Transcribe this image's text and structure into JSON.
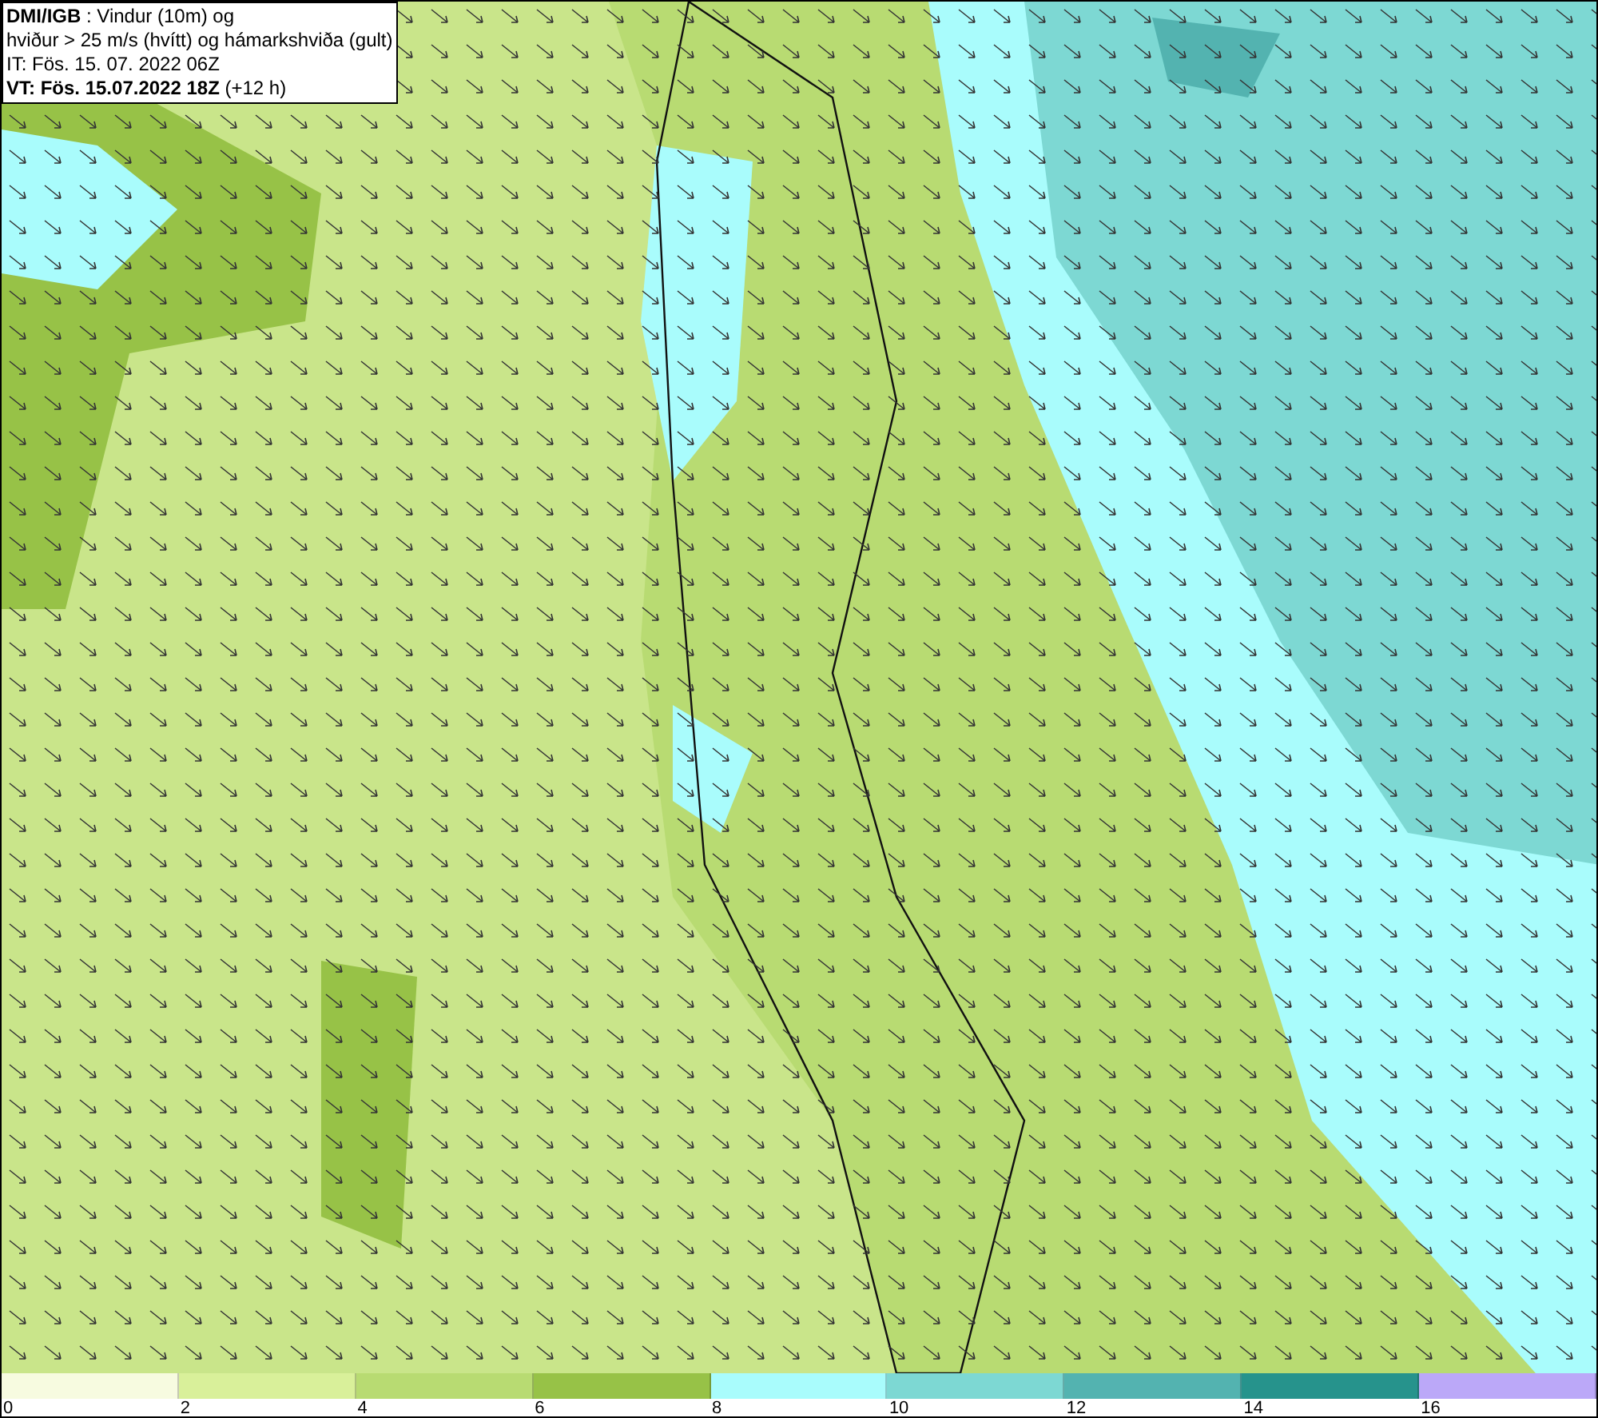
{
  "title_box": {
    "lines": [
      "**DMI/IGB** : Vindur (10m) og",
      "hviður > 25 m/s (hvítt) og hámarkshviða (gult)",
      "IT: Fös. 15. 07. 2022 06Z",
      "**VT: Fös. 15.07.2022 18Z** (+12 h)"
    ]
  },
  "legend": {
    "bins": [
      {
        "color": "#f7fbe0"
      },
      {
        "color": "#d9f09a"
      },
      {
        "color": "#b8db72"
      },
      {
        "color": "#97c247"
      },
      {
        "color": "#a9fcfc"
      },
      {
        "color": "#7dd8d3"
      },
      {
        "color": "#53b3b0"
      },
      {
        "color": "#26938c"
      },
      {
        "color": "#bba8f8"
      }
    ],
    "ticks": [
      "0",
      "2",
      "4",
      "6",
      "8",
      "10",
      "12",
      "14",
      "16"
    ]
  }
}
